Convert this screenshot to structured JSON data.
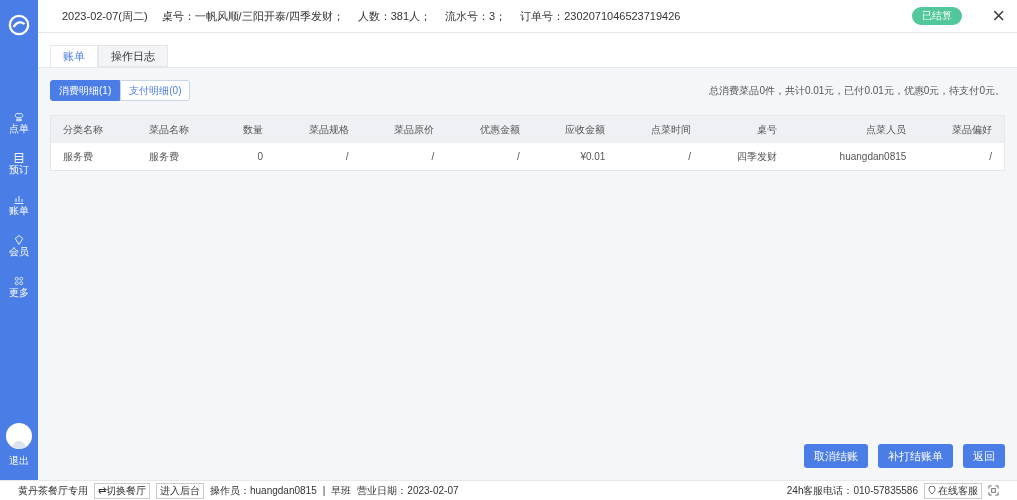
{
  "header": {
    "date": "2023-02-07(周二)",
    "table_no": "桌号：一帆风顺/三阳开泰/四季发财；",
    "guests": "人数：381人；",
    "serial": "流水号：3；",
    "order_no": "订单号：2302071046523719426",
    "status_badge": "已结算",
    "close": "×"
  },
  "sidebar": {
    "items": [
      {
        "label": "点单",
        "kind": "chef"
      },
      {
        "label": "预订",
        "kind": "book"
      },
      {
        "label": "账单",
        "kind": "chart"
      },
      {
        "label": "会员",
        "kind": "gem"
      },
      {
        "label": "更多",
        "kind": "grid"
      }
    ],
    "logout": "退出"
  },
  "tabs": [
    {
      "label": "账单",
      "selected": true
    },
    {
      "label": "操作日志",
      "selected": false
    }
  ],
  "subtabs": [
    {
      "label": "消费明细(1)",
      "selected": true
    },
    {
      "label": "支付明细(0)",
      "selected": false
    }
  ],
  "summary": "总消费菜品0件，共计0.01元，已付0.01元，优惠0元，待支付0元。",
  "table": {
    "columns": [
      "分类名称",
      "菜品名称",
      "数量",
      "菜品规格",
      "菜品原价",
      "优惠金额",
      "应收金额",
      "点菜时间",
      "桌号",
      "点菜人员",
      "菜品偏好"
    ],
    "rows": [
      [
        "服务费",
        "服务费",
        "0",
        "/",
        "/",
        "/",
        "¥0.01",
        "/",
        "四季发财",
        "huangdan0815",
        "/"
      ]
    ]
  },
  "actions": [
    "取消结账",
    "补打结账单",
    "返回"
  ],
  "status_bar": {
    "left": [
      {
        "kind": "text",
        "label": "黄丹茶餐厅专用"
      },
      {
        "kind": "button",
        "label": "⇄切换餐厅"
      },
      {
        "kind": "button",
        "label": "进入后台"
      },
      {
        "kind": "text",
        "label": "操作员：huangdan0815"
      },
      {
        "kind": "text",
        "label": "|"
      },
      {
        "kind": "text",
        "label": "早班"
      },
      {
        "kind": "text",
        "label": "营业日期：2023-02-07"
      }
    ],
    "hotline": "24h客服电话：010-57835586",
    "service": "在线客服"
  }
}
